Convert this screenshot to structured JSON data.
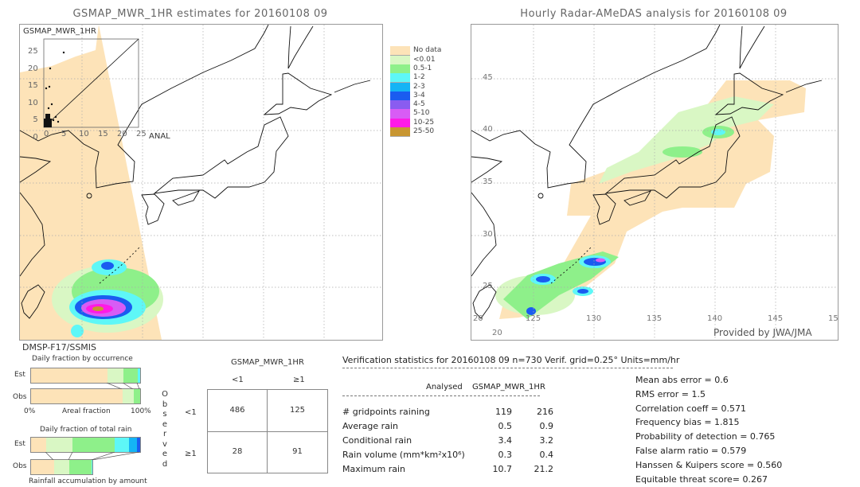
{
  "left_panel": {
    "title": "GSMAP_MWR_1HR estimates for 20160108 09",
    "inset_label": "GSMAP_MWR_1HR",
    "inset_x_label": "ANAL",
    "inset_ticks": [
      "0",
      "5",
      "10",
      "15",
      "20",
      "25"
    ],
    "sensor": "DMSP-F17/SSMIS"
  },
  "right_panel": {
    "title": "Hourly Radar-AMeDAS analysis for 20160108 09",
    "lat_labels": [
      "45",
      "40",
      "35",
      "30",
      "25",
      "20"
    ],
    "lon_labels": [
      "20",
      "125",
      "130",
      "135",
      "140",
      "145",
      "15"
    ],
    "credit": "Provided by JWA/JMA"
  },
  "legend": [
    {
      "label": "",
      "color": "#ffffff"
    },
    {
      "label": "No data",
      "color": "#fde3b8"
    },
    {
      "label": "<0.01",
      "color": "#d9f7c4"
    },
    {
      "label": "0.5-1",
      "color": "#8ef08a"
    },
    {
      "label": "1-2",
      "color": "#5ef7f7"
    },
    {
      "label": "2-3",
      "color": "#14b4f5"
    },
    {
      "label": "3-4",
      "color": "#1a5cf0"
    },
    {
      "label": "4-5",
      "color": "#8a5cf0"
    },
    {
      "label": "5-10",
      "color": "#d85cf5"
    },
    {
      "label": "10-25",
      "color": "#ff1ae6"
    },
    {
      "label": "25-50",
      "color": "#c89632"
    }
  ],
  "occurrence": {
    "title": "Daily fraction by occurrence",
    "est_label": "Est",
    "obs_label": "Obs",
    "axis_left": "0%",
    "axis_mid": "Areal fraction",
    "axis_right": "100%",
    "est_fractions": [
      0.7,
      0.15,
      0.13,
      0.02
    ],
    "obs_fractions": [
      0.84,
      0.1,
      0.06
    ],
    "colors": [
      "#fde3b8",
      "#d9f7c4",
      "#8ef08a",
      "#5ef7f7"
    ]
  },
  "total_rain": {
    "title": "Daily fraction of total rain",
    "est_label": "Est",
    "obs_label": "Obs",
    "footer": "Rainfall accumulation by amount",
    "est_fractions": [
      0.14,
      0.24,
      0.39,
      0.13,
      0.07,
      0.03
    ],
    "obs_fractions": [
      0.21,
      0.14,
      0.21,
      0.01
    ],
    "obs_total_fraction": 0.565,
    "colors": [
      "#fde3b8",
      "#d9f7c4",
      "#8ef08a",
      "#5ef7f7",
      "#14b4f5",
      "#1a5cf0"
    ]
  },
  "contingency": {
    "header": "GSMAP_MWR_1HR",
    "col_labels": [
      "<1",
      "≥1"
    ],
    "row_labels": [
      "<1",
      "≥1"
    ],
    "side_label": [
      "O",
      "b",
      "s",
      "e",
      "r",
      "v",
      "e",
      "d"
    ],
    "cells": [
      [
        "486",
        "125"
      ],
      [
        "28",
        "91"
      ]
    ]
  },
  "stats": {
    "title": "Verification statistics for 20160108 09   n=730   Verif. grid=0.25°   Units=mm/hr",
    "col_analysed": "Analysed",
    "col_est": "GSMAP_MWR_1HR",
    "rows": [
      {
        "label": "# gridpoints raining",
        "a": "119",
        "b": "216"
      },
      {
        "label": "Average rain",
        "a": "0.5",
        "b": "0.9"
      },
      {
        "label": "Conditional rain",
        "a": "3.4",
        "b": "3.2"
      },
      {
        "label": "Rain volume (mm*km²x10⁶)",
        "a": "0.3",
        "b": "0.4"
      },
      {
        "label": "Maximum rain",
        "a": "10.7",
        "b": "21.2"
      }
    ],
    "scores": [
      "Mean abs error = 0.6",
      "RMS error = 1.5",
      "Correlation coeff = 0.571",
      "Frequency bias = 1.815",
      "Probability of detection = 0.765",
      "False alarm ratio = 0.579",
      "Hanssen & Kuipers score = 0.560",
      "Equitable threat score= 0.267"
    ]
  }
}
